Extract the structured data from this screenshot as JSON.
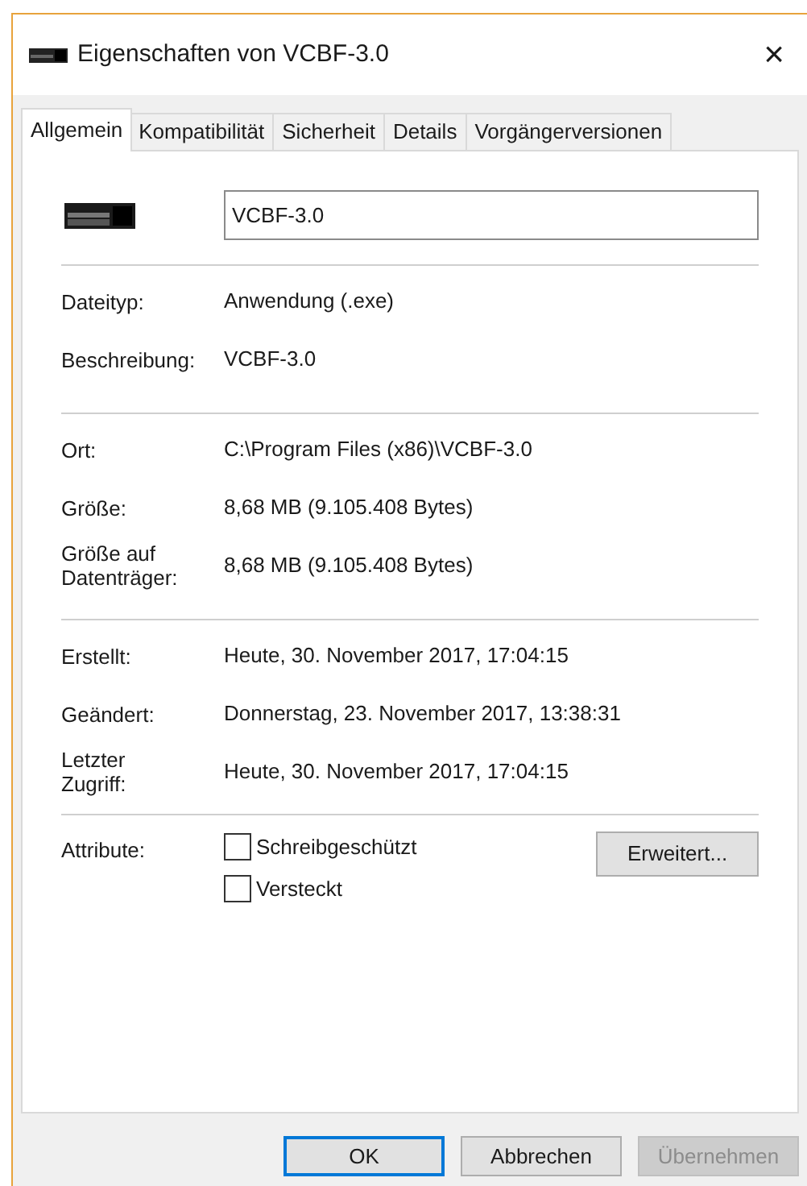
{
  "window": {
    "title": "Eigenschaften von VCBF-3.0",
    "close": "×"
  },
  "tabs": [
    {
      "label": "Allgemein",
      "selected": true
    },
    {
      "label": "Kompatibilität",
      "selected": false
    },
    {
      "label": "Sicherheit",
      "selected": false
    },
    {
      "label": "Details",
      "selected": false
    },
    {
      "label": "Vorgängerversionen",
      "selected": false
    }
  ],
  "name_field": {
    "value": "VCBF-3.0"
  },
  "sections": [
    [
      {
        "label": "Dateityp:",
        "value": "Anwendung (.exe)"
      },
      {
        "label": "Beschreibung:",
        "value": "VCBF-3.0"
      }
    ],
    [
      {
        "label": "Ort:",
        "value": "C:\\Program Files (x86)\\VCBF-3.0"
      },
      {
        "label": "Größe:",
        "value": "8,68 MB (9.105.408 Bytes)"
      },
      {
        "label": "Größe auf\nDatenträger:",
        "value": "8,68 MB (9.105.408 Bytes)"
      }
    ],
    [
      {
        "label": "Erstellt:",
        "value": "Heute, 30. November 2017, 17:04:15"
      },
      {
        "label": "Geändert:",
        "value": "Donnerstag, 23. November 2017, 13:38:31"
      },
      {
        "label": "Letzter\nZugriff:",
        "value": "Heute, 30. November 2017, 17:04:15"
      }
    ]
  ],
  "attributes": {
    "label": "Attribute:",
    "options": [
      {
        "label": "Schreibgeschützt",
        "checked": false
      },
      {
        "label": "Versteckt",
        "checked": false
      }
    ],
    "advanced_button": "Erweitert..."
  },
  "buttons": [
    {
      "label": "OK",
      "default": true,
      "disabled": false
    },
    {
      "label": "Abbrechen",
      "default": false,
      "disabled": false
    },
    {
      "label": "Übernehmen",
      "default": false,
      "disabled": true
    }
  ]
}
